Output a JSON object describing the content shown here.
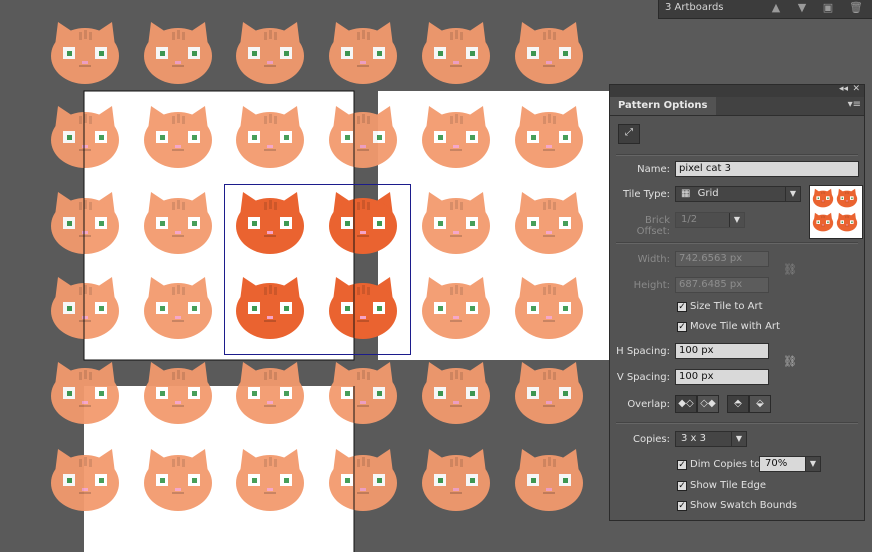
{
  "artboards_panel": {
    "count_label": "3 Artboards"
  },
  "panel": {
    "title": "Pattern Options",
    "tile_tool_icon": "pattern-tile-tool-icon",
    "name_label": "Name:",
    "name_value": "pixel cat 3",
    "tile_type_label": "Tile Type:",
    "tile_type_value": "Grid",
    "brick_offset_label": "Brick Offset:",
    "brick_offset_value": "1/2",
    "width_label": "Width:",
    "width_value": "742.6563 px",
    "height_label": "Height:",
    "height_value": "687.6485 px",
    "size_tile_label": "Size Tile to Art",
    "size_tile_checked": true,
    "move_tile_label": "Move Tile with Art",
    "move_tile_checked": true,
    "h_spacing_label": "H Spacing:",
    "h_spacing_value": "100 px",
    "v_spacing_label": "V Spacing:",
    "v_spacing_value": "100 px",
    "overlap_label": "Overlap:",
    "copies_label": "Copies:",
    "copies_value": "3 x 3",
    "dim_copies_label": "Dim Copies to:",
    "dim_copies_checked": true,
    "dim_copies_value": "70%",
    "show_tile_edge_label": "Show Tile Edge",
    "show_tile_edge_checked": true,
    "show_swatch_bounds_label": "Show Swatch Bounds",
    "show_swatch_bounds_checked": true
  },
  "colors": {
    "canvas_bg": "#5a5a5a",
    "cat_dim": "#f39a6e",
    "cat_active": "#ea6330",
    "tile_edge": "#1c1c8c"
  }
}
